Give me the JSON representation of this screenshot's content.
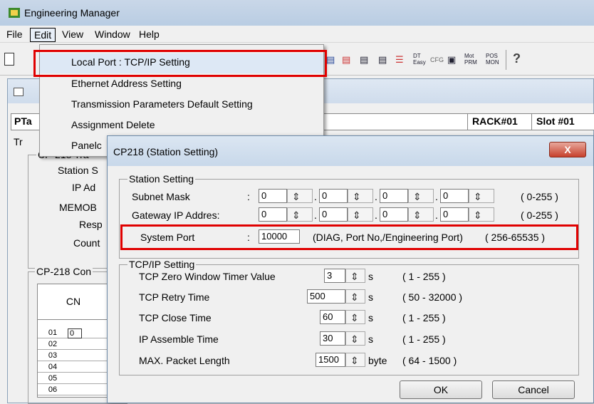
{
  "app": {
    "title": "Engineering Manager"
  },
  "menubar": {
    "items": [
      "File",
      "Edit",
      "View",
      "Window",
      "Help"
    ]
  },
  "toolbar": {
    "glyphs": [
      "DT Easy",
      "CFG",
      "Mot PRM",
      "POS MON"
    ]
  },
  "background": {
    "header_label": "PTa",
    "rack": "RACK#01",
    "slot": "Slot #01",
    "tr_label": "Tr",
    "group_top_legend": "CP-218 Tra",
    "rows": [
      "Station S",
      "IP Ad",
      "MEMOB",
      "Resp",
      "Count"
    ],
    "group_bottom_legend": "CP-218 Con",
    "table": {
      "header": "CN",
      "rows": [
        "01",
        "02",
        "03",
        "04",
        "05",
        "06"
      ],
      "first_cell": "0"
    }
  },
  "edit_menu": {
    "items": [
      "Local Port : TCP/IP Setting",
      "Ethernet Address Setting",
      "Transmission Parameters Default Setting",
      "Assignment Delete",
      "Panelc"
    ]
  },
  "dialog": {
    "title": "CP218 (Station Setting)",
    "close": "X",
    "station_setting": {
      "legend": "Station Setting",
      "subnet_mask": {
        "label": "Subnet Mask",
        "values": [
          "0",
          "0",
          "0",
          "0"
        ],
        "range": "( 0-255 )"
      },
      "gateway": {
        "label": "Gateway IP Addres:",
        "values": [
          "0",
          "0",
          "0",
          "0"
        ],
        "range": "( 0-255 )"
      },
      "system_port": {
        "label": "System Port",
        "value": "10000",
        "note": "(DIAG, Port No,/Engineering Port)",
        "range": "( 256-65535 )"
      }
    },
    "tcpip_setting": {
      "legend": "TCP/IP Setting",
      "rows": [
        {
          "label": "TCP Zero Window Timer Value",
          "value": "3",
          "unit": "s",
          "range": "( 1 - 255 )"
        },
        {
          "label": "TCP Retry Time",
          "value": "500",
          "unit": "s",
          "range": "( 50 - 32000 )"
        },
        {
          "label": "TCP Close Time",
          "value": "60",
          "unit": "s",
          "range": "( 1 - 255 )"
        },
        {
          "label": "IP  Assemble Time",
          "value": "30",
          "unit": "s",
          "range": "( 1 - 255 )"
        },
        {
          "label": "MAX. Packet Length",
          "value": "1500",
          "unit": "byte",
          "range": "( 64 - 1500 )"
        }
      ]
    },
    "buttons": {
      "ok": "OK",
      "cancel": "Cancel"
    }
  },
  "colors": {
    "highlight": "#e00000",
    "accent": "#6d8aa8"
  }
}
